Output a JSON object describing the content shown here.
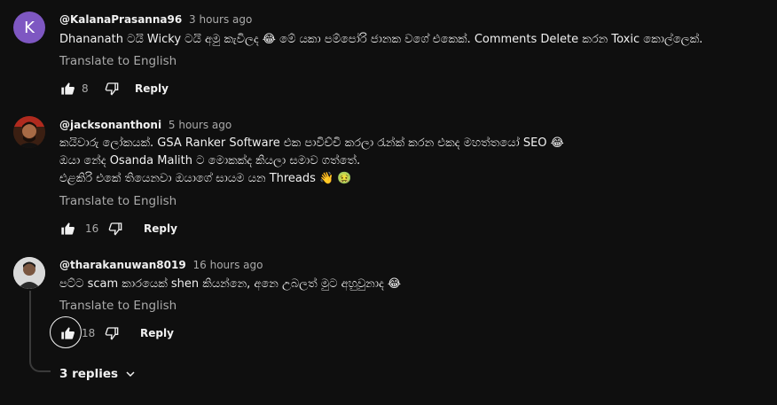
{
  "comments": [
    {
      "author": "@KalanaPrasanna96",
      "time": "3 hours ago",
      "avatar_letter": "K",
      "avatar_color": "#7e57c2",
      "lines": [
        "Dhananath ටයි Wicky ටයි අමු කැවිලද 😂 මේ යකා පම්පෝරි ජානක වගේ එකෙක්. Comments Delete කරන Toxic කොල්ලෙක්."
      ],
      "translate": "Translate to English",
      "likes": "8",
      "reply": "Reply"
    },
    {
      "author": "@jacksonanthoni",
      "time": "5 hours ago",
      "avatar_icon": "avatar-photo-icon",
      "lines": [
        "කයිවාරු ලෝකයක්. GSA Ranker Software එක පාවිච්චි කරලා රැන්ක් කරන එකද මහත්තයෝ SEO 😂",
        "ඔයා නේද Osanda Malith ට මොකක්ද කියලා සමාව ගත්තේ.",
        "එළකිරි එකේ තියෙනවා ඔයාගේ සායම යන Threads 👋 🤢"
      ],
      "translate": "Translate to English",
      "likes": "16",
      "reply": "Reply"
    },
    {
      "author": "@tharakanuwan8019",
      "time": "16 hours ago",
      "avatar_icon": "avatar-photo-icon",
      "lines": [
        "පට්ට scam කාරයෙක් shen කියන්නෙ, අනෙ උබලත් මුට අහුවුනාද 😂"
      ],
      "translate": "Translate to English",
      "likes": "18",
      "reply": "Reply"
    }
  ],
  "replies_toggle": "3 replies"
}
